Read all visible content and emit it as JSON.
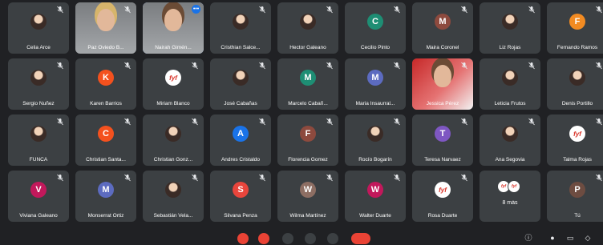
{
  "participants": [
    {
      "name": "Celia Arce",
      "avatar": "photo",
      "muted": true
    },
    {
      "name": "Paz Oviedo B...",
      "avatar": "video",
      "muted": true
    },
    {
      "name": "Nairah Gimén...",
      "avatar": "video",
      "muted": false,
      "active": true
    },
    {
      "name": "Cristhian Salce...",
      "avatar": "photo",
      "muted": true
    },
    {
      "name": "Hector Galeano",
      "avatar": "photo",
      "muted": true
    },
    {
      "name": "Cecilio Pinto",
      "avatar": "letter",
      "letter": "C",
      "color": "#1e8e74",
      "muted": true
    },
    {
      "name": "Maira Coronel",
      "avatar": "letter",
      "letter": "M",
      "color": "#8d4a3e",
      "muted": true
    },
    {
      "name": "Liz Rojas",
      "avatar": "photo",
      "muted": true
    },
    {
      "name": "Fernando Ramos",
      "avatar": "letter",
      "letter": "F",
      "color": "#f28b22",
      "muted": true
    },
    {
      "name": "Sergio Nuñez",
      "avatar": "photo",
      "muted": true
    },
    {
      "name": "Karen Barrios",
      "avatar": "letter",
      "letter": "K",
      "color": "#f4511e",
      "muted": true
    },
    {
      "name": "Miriam Blanco",
      "avatar": "logo",
      "muted": true
    },
    {
      "name": "José Cabañas",
      "avatar": "photo",
      "muted": true
    },
    {
      "name": "Marcelo Cabañ...",
      "avatar": "letter",
      "letter": "M",
      "color": "#1e8e74",
      "muted": true
    },
    {
      "name": "Maria Insaurral...",
      "avatar": "letter",
      "letter": "M",
      "color": "#5c6bc0",
      "muted": true
    },
    {
      "name": "Jessica Pérez",
      "avatar": "video-red",
      "muted": true
    },
    {
      "name": "Leticia Frutos",
      "avatar": "photo",
      "muted": true
    },
    {
      "name": "Denis Portillo",
      "avatar": "photo",
      "muted": true
    },
    {
      "name": "FUNCA",
      "avatar": "photo",
      "muted": true
    },
    {
      "name": "Christian Santa...",
      "avatar": "letter",
      "letter": "C",
      "color": "#f4511e",
      "muted": true
    },
    {
      "name": "Christian Gonz...",
      "avatar": "photo",
      "muted": true
    },
    {
      "name": "Andres Cristaldo",
      "avatar": "letter",
      "letter": "A",
      "color": "#1a73e8",
      "muted": true
    },
    {
      "name": "Florencia Gomez",
      "avatar": "letter",
      "letter": "F",
      "color": "#8d4a3e",
      "muted": true
    },
    {
      "name": "Rocío Bogarín",
      "avatar": "photo",
      "muted": true
    },
    {
      "name": "Teresa Narvaez",
      "avatar": "letter",
      "letter": "T",
      "color": "#7e57c2",
      "muted": true
    },
    {
      "name": "Ana Segovia",
      "avatar": "photo",
      "muted": true
    },
    {
      "name": "Talma Rojas",
      "avatar": "logo",
      "muted": true
    },
    {
      "name": "Viviana Galeano",
      "avatar": "letter",
      "letter": "V",
      "color": "#c2185b",
      "muted": true
    },
    {
      "name": "Monserrat Ortiz",
      "avatar": "letter",
      "letter": "M",
      "color": "#5c6bc0",
      "muted": true
    },
    {
      "name": "Sebastián Vela...",
      "avatar": "photo",
      "muted": true
    },
    {
      "name": "Silvana Penza",
      "avatar": "letter",
      "letter": "S",
      "color": "#e8453c",
      "muted": true
    },
    {
      "name": "Wilma Martínez",
      "avatar": "letter",
      "letter": "W",
      "color": "#8d6e63",
      "muted": true
    },
    {
      "name": "Walter Duarte",
      "avatar": "letter",
      "letter": "W",
      "color": "#c2185b",
      "muted": true
    },
    {
      "name": "Rosa Duarte",
      "avatar": "logo",
      "muted": true
    },
    {
      "name": "8 más",
      "avatar": "more",
      "muted": false
    },
    {
      "name": "Tú",
      "avatar": "letter",
      "letter": "P",
      "color": "#6d4c41",
      "muted": true
    }
  ],
  "logo_text": "fyf",
  "colors": {
    "background": "#202124",
    "tile": "#3c4043",
    "accent": "#1a73e8",
    "end_call": "#ea4335"
  }
}
